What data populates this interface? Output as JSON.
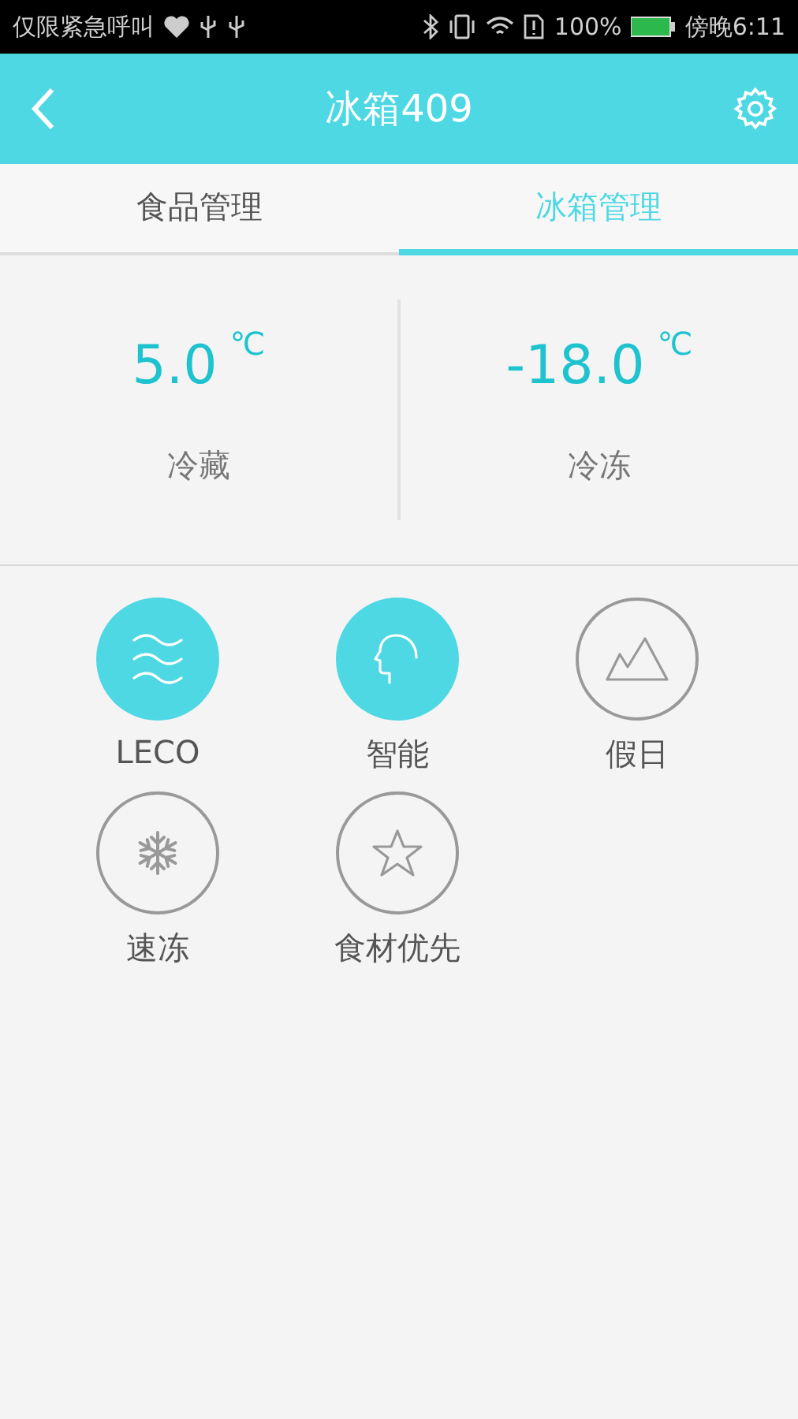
{
  "status_bar": {
    "carrier": "仅限紧急呼叫",
    "battery_text": "100%",
    "time": "傍晚6:11"
  },
  "header": {
    "title": "冰箱409"
  },
  "tabs": [
    {
      "label": "食品管理",
      "selected": false
    },
    {
      "label": "冰箱管理",
      "selected": true
    }
  ],
  "temperatures": [
    {
      "value": "5.0",
      "unit": "℃",
      "label": "冷藏"
    },
    {
      "value": "-18.0",
      "unit": "℃",
      "label": "冷冻"
    }
  ],
  "modes": [
    {
      "kind": "waves",
      "label": "LECO",
      "selected": true
    },
    {
      "kind": "head",
      "label": "智能",
      "selected": true
    },
    {
      "kind": "mountain",
      "label": "假日",
      "selected": false
    },
    {
      "kind": "snowflake",
      "label": "速冻",
      "selected": false
    },
    {
      "kind": "star",
      "label": "食材优先",
      "selected": false
    }
  ]
}
